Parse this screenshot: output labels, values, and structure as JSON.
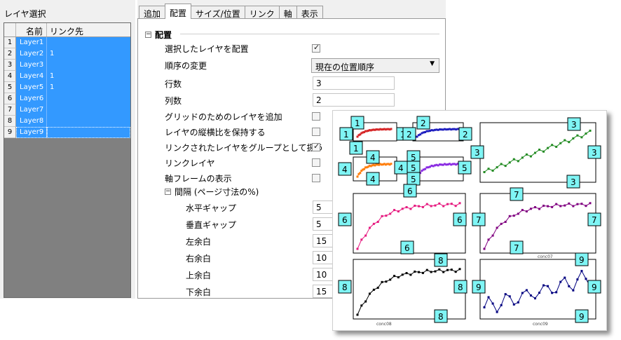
{
  "left_panel": {
    "title": "レイヤ選択",
    "columns": [
      "名前",
      "リンク先"
    ],
    "rows": [
      {
        "num": "1",
        "name": "Layer1",
        "link": ""
      },
      {
        "num": "2",
        "name": "Layer2",
        "link": "1"
      },
      {
        "num": "3",
        "name": "Layer3",
        "link": ""
      },
      {
        "num": "4",
        "name": "Layer4",
        "link": "1"
      },
      {
        "num": "5",
        "name": "Layer5",
        "link": "1"
      },
      {
        "num": "6",
        "name": "Layer6",
        "link": ""
      },
      {
        "num": "7",
        "name": "Layer7",
        "link": ""
      },
      {
        "num": "8",
        "name": "Layer8",
        "link": ""
      },
      {
        "num": "9",
        "name": "Layer9",
        "link": ""
      }
    ]
  },
  "tabs": [
    "追加",
    "配置",
    "サイズ/位置",
    "リンク",
    "軸",
    "表示"
  ],
  "active_tab": "配置",
  "section": {
    "title": "配置",
    "arrange_selected": {
      "label": "選択したレイヤを配置",
      "checked": true
    },
    "order_change": {
      "label": "順序の変更",
      "value": "現在の位置順序"
    },
    "rows": {
      "label": "行数",
      "value": "3"
    },
    "cols": {
      "label": "列数",
      "value": "2"
    },
    "add_layers": {
      "label": "グリッドのためのレイヤを追加",
      "checked": false
    },
    "keep_aspect": {
      "label": "レイヤの縦横比を保持する",
      "checked": false
    },
    "group_linked": {
      "label": "リンクされたレイヤをグループとして扱う",
      "checked": true
    },
    "link_layers": {
      "label": "リンクレイヤ",
      "checked": false
    },
    "show_frame": {
      "label": "軸フレームの表示",
      "checked": false
    }
  },
  "spacing": {
    "title": "間隔 (ページ寸法の%)",
    "h_gap": {
      "label": "水平ギャップ",
      "value": "5"
    },
    "v_gap": {
      "label": "垂直ギャップ",
      "value": "5"
    },
    "left": {
      "label": "左余白",
      "value": "15"
    },
    "right": {
      "label": "右余白",
      "value": "10"
    },
    "top": {
      "label": "上余白",
      "value": "10"
    },
    "bottom": {
      "label": "下余白",
      "value": "15"
    }
  },
  "graph": {
    "xlabels": {
      "l7": "conc07",
      "l8": "conc08",
      "l9": "conc09"
    },
    "colors": [
      "#d62728",
      "#1f1fbf",
      "#228b22",
      "#ff7f0e",
      "#8a2be2",
      "#e6197f",
      "#800080",
      "#000000",
      "#000080"
    ],
    "badge_color": "#7ff5f5"
  }
}
